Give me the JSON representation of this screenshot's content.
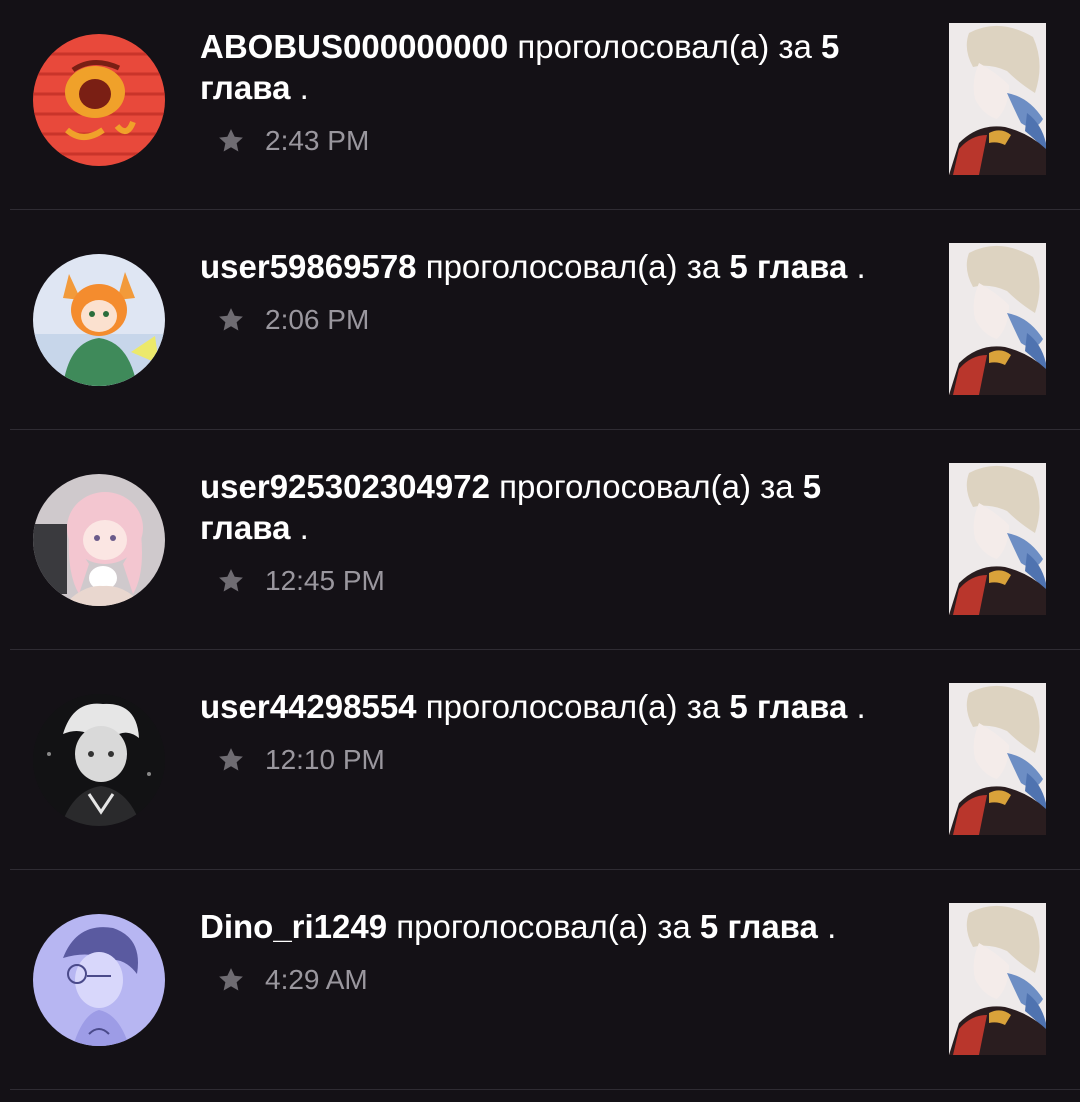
{
  "notifications": [
    {
      "username": "ABOBUS000000000",
      "action": "проголосовал(а) за",
      "chapter": "5 глава",
      "trailing": ".",
      "time": "2:43 PM",
      "avatar_icon": "red-doodle-avatar"
    },
    {
      "username": "user59869578",
      "action": "проголосовал(а) за",
      "chapter": "5 глава",
      "trailing": ".",
      "time": "2:06 PM",
      "avatar_icon": "fox-girl-avatar"
    },
    {
      "username": "user925302304972",
      "action": "проголосовал(а) за",
      "chapter": "5 глава",
      "trailing": ".",
      "time": "12:45 PM",
      "avatar_icon": "pink-hair-avatar"
    },
    {
      "username": "user44298554",
      "action": "проголосовал(а) за",
      "chapter": "5 глава",
      "trailing": ".",
      "time": "12:10 PM",
      "avatar_icon": "monochrome-avatar"
    },
    {
      "username": "Dino_ri1249",
      "action": "проголосовал(а) за",
      "chapter": "5 глава",
      "trailing": ".",
      "time": "4:29 AM",
      "avatar_icon": "lavender-sketch-avatar"
    }
  ],
  "icons": {
    "vote": "star-icon",
    "cover": "story-cover-thumbnail"
  },
  "colors": {
    "background": "#141116",
    "divider": "#2f2c33",
    "primary_text": "#ffffff",
    "secondary_text": "#9a979e",
    "star": "#6f6c72"
  }
}
